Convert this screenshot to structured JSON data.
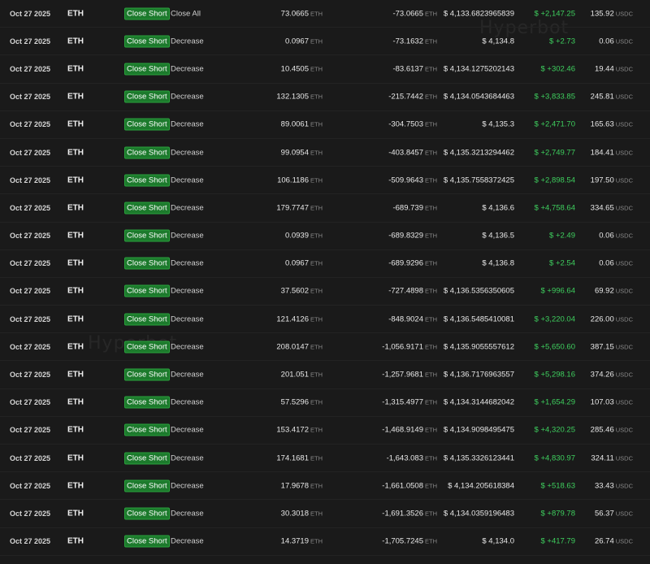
{
  "watermark": "Hyperbot",
  "rows": [
    {
      "date": "Oct 27 2025",
      "asset": "ETH",
      "action": "Close Short",
      "dir": "Close All",
      "size": "73.0665",
      "size_unit": "ETH",
      "position": "-73.0665",
      "position_unit": "ETH",
      "price": "$ 4,133.6823965839",
      "pnl": "$ +2,147.25",
      "fee": "135.92",
      "fee_unit": "USDC"
    },
    {
      "date": "Oct 27 2025",
      "asset": "ETH",
      "action": "Close Short",
      "dir": "Decrease",
      "size": "0.0967",
      "size_unit": "ETH",
      "position": "-73.1632",
      "position_unit": "ETH",
      "price": "$ 4,134.8",
      "pnl": "$ +2.73",
      "fee": "0.06",
      "fee_unit": "USDC"
    },
    {
      "date": "Oct 27 2025",
      "asset": "ETH",
      "action": "Close Short",
      "dir": "Decrease",
      "size": "10.4505",
      "size_unit": "ETH",
      "position": "-83.6137",
      "position_unit": "ETH",
      "price": "$ 4,134.1275202143",
      "pnl": "$ +302.46",
      "fee": "19.44",
      "fee_unit": "USDC"
    },
    {
      "date": "Oct 27 2025",
      "asset": "ETH",
      "action": "Close Short",
      "dir": "Decrease",
      "size": "132.1305",
      "size_unit": "ETH",
      "position": "-215.7442",
      "position_unit": "ETH",
      "price": "$ 4,134.0543684463",
      "pnl": "$ +3,833.85",
      "fee": "245.81",
      "fee_unit": "USDC"
    },
    {
      "date": "Oct 27 2025",
      "asset": "ETH",
      "action": "Close Short",
      "dir": "Decrease",
      "size": "89.0061",
      "size_unit": "ETH",
      "position": "-304.7503",
      "position_unit": "ETH",
      "price": "$ 4,135.3",
      "pnl": "$ +2,471.70",
      "fee": "165.63",
      "fee_unit": "USDC"
    },
    {
      "date": "Oct 27 2025",
      "asset": "ETH",
      "action": "Close Short",
      "dir": "Decrease",
      "size": "99.0954",
      "size_unit": "ETH",
      "position": "-403.8457",
      "position_unit": "ETH",
      "price": "$ 4,135.3213294462",
      "pnl": "$ +2,749.77",
      "fee": "184.41",
      "fee_unit": "USDC"
    },
    {
      "date": "Oct 27 2025",
      "asset": "ETH",
      "action": "Close Short",
      "dir": "Decrease",
      "size": "106.1186",
      "size_unit": "ETH",
      "position": "-509.9643",
      "position_unit": "ETH",
      "price": "$ 4,135.7558372425",
      "pnl": "$ +2,898.54",
      "fee": "197.50",
      "fee_unit": "USDC"
    },
    {
      "date": "Oct 27 2025",
      "asset": "ETH",
      "action": "Close Short",
      "dir": "Decrease",
      "size": "179.7747",
      "size_unit": "ETH",
      "position": "-689.739",
      "position_unit": "ETH",
      "price": "$ 4,136.6",
      "pnl": "$ +4,758.64",
      "fee": "334.65",
      "fee_unit": "USDC"
    },
    {
      "date": "Oct 27 2025",
      "asset": "ETH",
      "action": "Close Short",
      "dir": "Decrease",
      "size": "0.0939",
      "size_unit": "ETH",
      "position": "-689.8329",
      "position_unit": "ETH",
      "price": "$ 4,136.5",
      "pnl": "$ +2.49",
      "fee": "0.06",
      "fee_unit": "USDC"
    },
    {
      "date": "Oct 27 2025",
      "asset": "ETH",
      "action": "Close Short",
      "dir": "Decrease",
      "size": "0.0967",
      "size_unit": "ETH",
      "position": "-689.9296",
      "position_unit": "ETH",
      "price": "$ 4,136.8",
      "pnl": "$ +2.54",
      "fee": "0.06",
      "fee_unit": "USDC"
    },
    {
      "date": "Oct 27 2025",
      "asset": "ETH",
      "action": "Close Short",
      "dir": "Decrease",
      "size": "37.5602",
      "size_unit": "ETH",
      "position": "-727.4898",
      "position_unit": "ETH",
      "price": "$ 4,136.5356350605",
      "pnl": "$ +996.64",
      "fee": "69.92",
      "fee_unit": "USDC"
    },
    {
      "date": "Oct 27 2025",
      "asset": "ETH",
      "action": "Close Short",
      "dir": "Decrease",
      "size": "121.4126",
      "size_unit": "ETH",
      "position": "-848.9024",
      "position_unit": "ETH",
      "price": "$ 4,136.5485410081",
      "pnl": "$ +3,220.04",
      "fee": "226.00",
      "fee_unit": "USDC"
    },
    {
      "date": "Oct 27 2025",
      "asset": "ETH",
      "action": "Close Short",
      "dir": "Decrease",
      "size": "208.0147",
      "size_unit": "ETH",
      "position": "-1,056.9171",
      "position_unit": "ETH",
      "price": "$ 4,135.9055557612",
      "pnl": "$ +5,650.60",
      "fee": "387.15",
      "fee_unit": "USDC"
    },
    {
      "date": "Oct 27 2025",
      "asset": "ETH",
      "action": "Close Short",
      "dir": "Decrease",
      "size": "201.051",
      "size_unit": "ETH",
      "position": "-1,257.9681",
      "position_unit": "ETH",
      "price": "$ 4,136.7176963557",
      "pnl": "$ +5,298.16",
      "fee": "374.26",
      "fee_unit": "USDC"
    },
    {
      "date": "Oct 27 2025",
      "asset": "ETH",
      "action": "Close Short",
      "dir": "Decrease",
      "size": "57.5296",
      "size_unit": "ETH",
      "position": "-1,315.4977",
      "position_unit": "ETH",
      "price": "$ 4,134.3144682042",
      "pnl": "$ +1,654.29",
      "fee": "107.03",
      "fee_unit": "USDC"
    },
    {
      "date": "Oct 27 2025",
      "asset": "ETH",
      "action": "Close Short",
      "dir": "Decrease",
      "size": "153.4172",
      "size_unit": "ETH",
      "position": "-1,468.9149",
      "position_unit": "ETH",
      "price": "$ 4,134.9098495475",
      "pnl": "$ +4,320.25",
      "fee": "285.46",
      "fee_unit": "USDC"
    },
    {
      "date": "Oct 27 2025",
      "asset": "ETH",
      "action": "Close Short",
      "dir": "Decrease",
      "size": "174.1681",
      "size_unit": "ETH",
      "position": "-1,643.083",
      "position_unit": "ETH",
      "price": "$ 4,135.3326123441",
      "pnl": "$ +4,830.97",
      "fee": "324.11",
      "fee_unit": "USDC"
    },
    {
      "date": "Oct 27 2025",
      "asset": "ETH",
      "action": "Close Short",
      "dir": "Decrease",
      "size": "17.9678",
      "size_unit": "ETH",
      "position": "-1,661.0508",
      "position_unit": "ETH",
      "price": "$ 4,134.205618384",
      "pnl": "$ +518.63",
      "fee": "33.43",
      "fee_unit": "USDC"
    },
    {
      "date": "Oct 27 2025",
      "asset": "ETH",
      "action": "Close Short",
      "dir": "Decrease",
      "size": "30.3018",
      "size_unit": "ETH",
      "position": "-1,691.3526",
      "position_unit": "ETH",
      "price": "$ 4,134.0359196483",
      "pnl": "$ +879.78",
      "fee": "56.37",
      "fee_unit": "USDC"
    },
    {
      "date": "Oct 27 2025",
      "asset": "ETH",
      "action": "Close Short",
      "dir": "Decrease",
      "size": "14.3719",
      "size_unit": "ETH",
      "position": "-1,705.7245",
      "position_unit": "ETH",
      "price": "$ 4,134.0",
      "pnl": "$ +417.79",
      "fee": "26.74",
      "fee_unit": "USDC"
    }
  ]
}
